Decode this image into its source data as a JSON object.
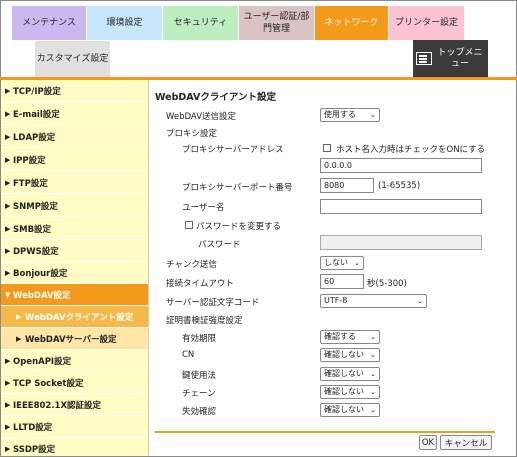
{
  "tabs": [
    {
      "label": "メンテナンス",
      "bg": "#cbb8f0"
    },
    {
      "label": "環境設定",
      "bg": "#c8e6fb"
    },
    {
      "label": "セキュリティ",
      "bg": "#bdeec0"
    },
    {
      "label": "ユーザー認証/部門管理",
      "bg": "#dcc3c3"
    },
    {
      "label": "ネットワーク",
      "bg": "#f39a1a"
    },
    {
      "label": "プリンター設定",
      "bg": "#fbc3d2"
    },
    {
      "label": "カスタマイズ設定",
      "bg": "#e0e0e0"
    }
  ],
  "top_menu": {
    "label": "トップメニュー",
    "icon": "top-menu-icon"
  },
  "sidebar": {
    "items": [
      {
        "label": "TCP/IP設定"
      },
      {
        "label": "E-mail設定"
      },
      {
        "label": "LDAP設定"
      },
      {
        "label": "IPP設定"
      },
      {
        "label": "FTP設定"
      },
      {
        "label": "SNMP設定"
      },
      {
        "label": "SMB設定"
      },
      {
        "label": "DPWS設定"
      },
      {
        "label": "Bonjour設定"
      },
      {
        "label": "WebDAV設定"
      },
      {
        "label": "WebDAVクライアント設定"
      },
      {
        "label": "WebDAVサーバー設定"
      },
      {
        "label": "OpenAPI設定"
      },
      {
        "label": "TCP Socket設定"
      },
      {
        "label": "IEEE802.1X認証設定"
      },
      {
        "label": "LLTD設定"
      },
      {
        "label": "SSDP設定"
      }
    ]
  },
  "main": {
    "title": "WebDAVクライアント設定",
    "webdav_send": {
      "label": "WebDAV送信設定",
      "value": "使用する"
    },
    "proxy": {
      "label": "プロキシ設定",
      "address_label": "プロキシサーバーアドレス",
      "hostname_check_label": "ホスト名入力時はチェックをONにする",
      "address_value": "0.0.0.0",
      "port_label": "プロキシサーバーポート番号",
      "port_value": "8080",
      "port_range": "(1-65535)",
      "user_label": "ユーザー名",
      "user_value": "",
      "change_password_label": "パスワードを変更する",
      "password_label": "パスワード",
      "password_value": ""
    },
    "chunk": {
      "label": "チャンク送信",
      "value": "しない"
    },
    "timeout": {
      "label": "接続タイムアウト",
      "value": "60",
      "unit": "秒(5-300)"
    },
    "charset": {
      "label": "サーバー認証文字コード",
      "value": "UTF-8"
    },
    "cert": {
      "label": "証明書検証強度設定",
      "expiry": {
        "label": "有効期限",
        "value": "確認する"
      },
      "cn": {
        "label": "CN",
        "value": "確認しない"
      },
      "key_usage": {
        "label": "鍵使用法",
        "value": "確認しない"
      },
      "chain": {
        "label": "チェーン",
        "value": "確認しない"
      },
      "revocation": {
        "label": "失効確認",
        "value": "確認しない"
      }
    },
    "ok_label": "OK",
    "cancel_label": "キャンセル"
  }
}
